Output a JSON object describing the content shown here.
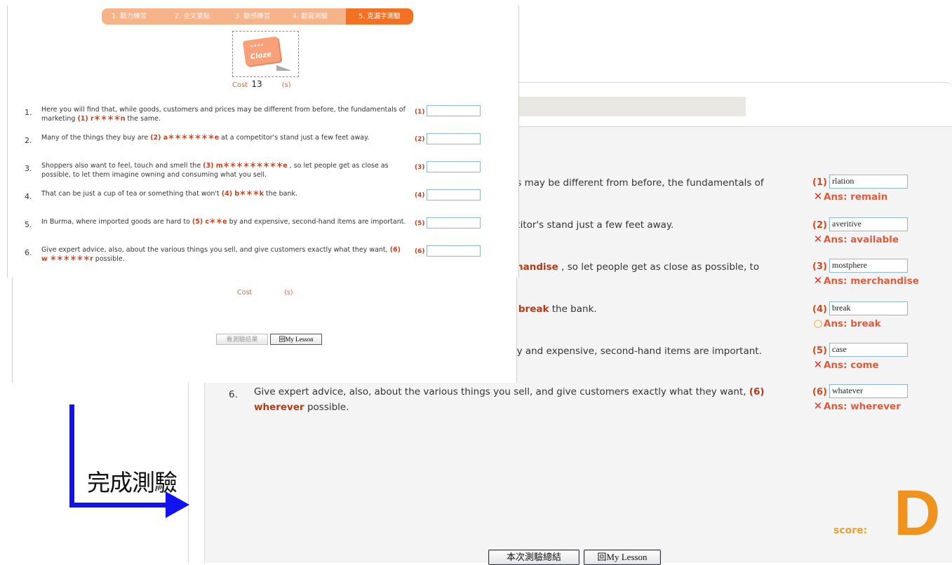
{
  "result": {
    "questions": [
      {
        "num": "6.",
        "text_parts": [
          "Give expert advice, also, about the various things you sell, and give customers exactly what they want, ",
          "(6)",
          " ",
          "wherever",
          " possible."
        ]
      }
    ],
    "fragments": {
      "q1": "es may be different from before, the fundamentals of",
      "q2": "etitor's stand just a few feet away.",
      "q3_bold": "chandise",
      "q3_rest": " , so let people get as close as possible, to",
      "q4_bold": ") break",
      "q4_rest": " the bank.",
      "q5": "by and expensive, second-hand items are important."
    },
    "answers": [
      {
        "label": "(1)",
        "input": "rlation",
        "mark": "✕",
        "status": "wrong",
        "ans": "Ans: remain"
      },
      {
        "label": "(2)",
        "input": "averitive",
        "mark": "✕",
        "status": "wrong",
        "ans": "Ans: available"
      },
      {
        "label": "(3)",
        "input": "mostphere",
        "mark": "✕",
        "status": "wrong",
        "ans": "Ans: merchandise"
      },
      {
        "label": "(4)",
        "input": "break",
        "mark": "○",
        "status": "right",
        "ans": "Ans: break"
      },
      {
        "label": "(5)",
        "input": "case",
        "mark": "✕",
        "status": "wrong",
        "ans": "Ans: come"
      },
      {
        "label": "(6)",
        "input": "whatever",
        "mark": "✕",
        "status": "wrong",
        "ans": "Ans: wherever"
      }
    ],
    "score_label": "score:",
    "score_grade": "D",
    "buttons": {
      "summary": "本次測驗總結",
      "back": "回My Lesson"
    }
  },
  "quiz": {
    "tabs": [
      "1. 聽力練習",
      "2. 全文重點",
      "3. 聽感練習",
      "4. 聽寫測驗",
      "5. 克漏字測驗"
    ],
    "active_tab": 4,
    "icon": {
      "stars": "****",
      "word": "Cloze"
    },
    "cost_label": "Cost",
    "cost_value": "13",
    "cost_unit": "(s)",
    "questions": [
      {
        "num": "1.",
        "pre": "Here you will find that, while goods, customers and prices may be different from before, the fundamentals of marketing ",
        "blank": "(1) r＊＊＊＊n",
        "post": " the same.",
        "label": "(1)"
      },
      {
        "num": "2.",
        "pre": "Many of the things they buy are ",
        "blank": "(2) a＊＊＊＊＊＊＊e",
        "post": " at a competitor's stand just a few feet away.",
        "label": "(2)"
      },
      {
        "num": "3.",
        "pre": "Shoppers also want to feel, touch and smell the ",
        "blank": "(3) m＊＊＊＊＊＊＊＊＊e",
        "post": " , so let people get as close as possible, to let them imagine owning and consuming what you sell.",
        "label": "(3)"
      },
      {
        "num": "4.",
        "pre": "That can be just a cup of tea or something that won't ",
        "blank": "(4) b＊＊＊k",
        "post": " the bank.",
        "label": "(4)"
      },
      {
        "num": "5.",
        "pre": "In Burma, where imported goods are hard to ",
        "blank": "(5) c＊＊e",
        "post": " by and expensive, second-hand items are important.",
        "label": "(5)"
      },
      {
        "num": "6.",
        "pre": "Give expert advice, also, about the various things you sell, and give customers exactly what they want, ",
        "blank": "(6) w ＊＊＊＊＊＊r",
        "post": " possible.",
        "label": "(6)"
      }
    ],
    "buttons": {
      "view_result": "看測驗結果",
      "back": "回My Lesson"
    }
  },
  "annotation": {
    "caption": "完成測驗",
    "arrow_color": "#1212ee"
  }
}
